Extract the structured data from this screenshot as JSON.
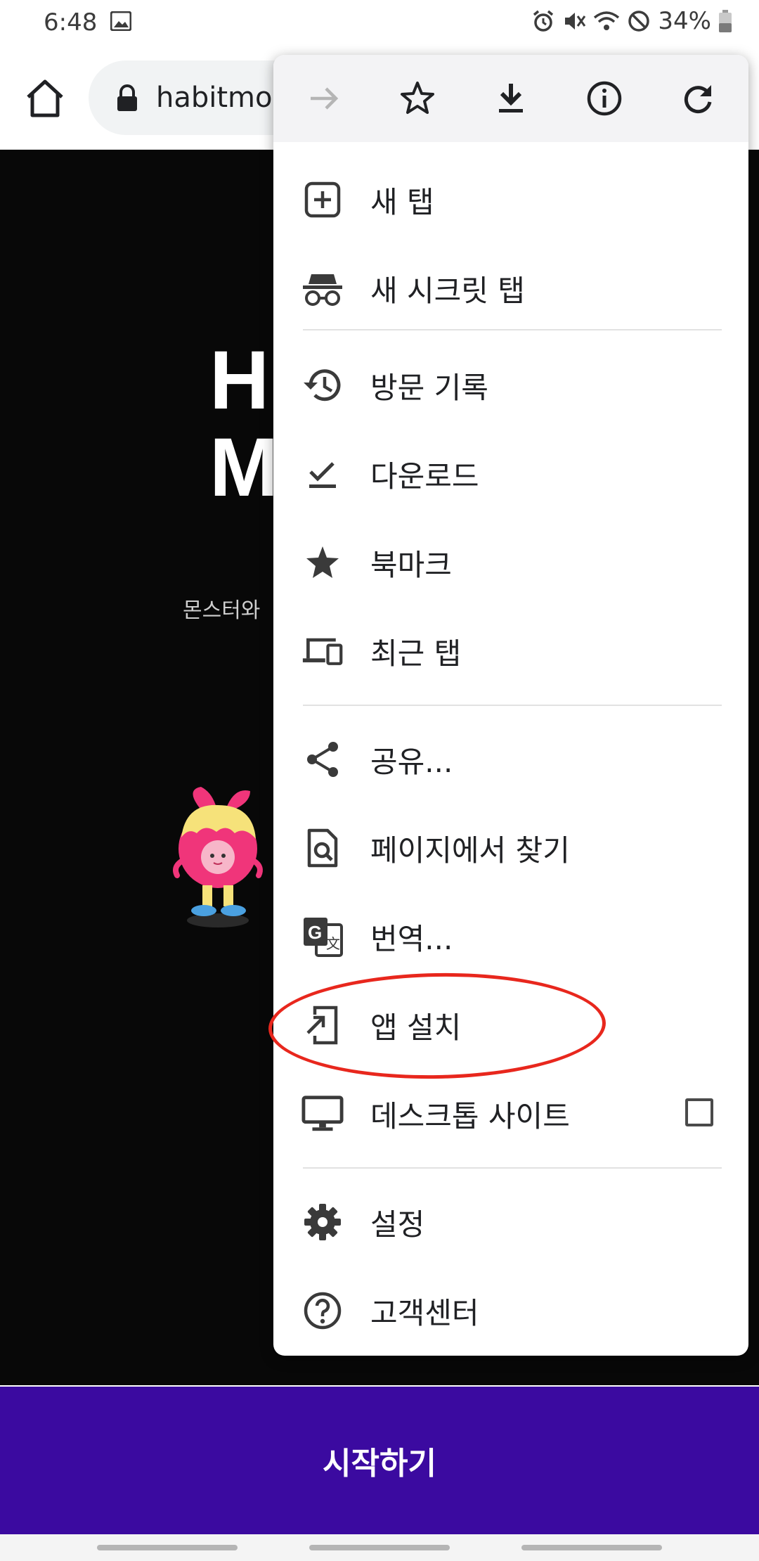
{
  "status": {
    "time": "6:48",
    "battery": "34%"
  },
  "browser": {
    "url": "habitmo"
  },
  "page": {
    "hero_line1": "H",
    "hero_line2": "M",
    "subtitle": "몬스터와",
    "start_button": "시작하기"
  },
  "menu": {
    "top_icons": [
      "forward-icon",
      "bookmark-star-icon",
      "download-icon",
      "info-icon",
      "refresh-icon"
    ],
    "items": [
      {
        "label": "새 탭",
        "icon": "new-tab-icon"
      },
      {
        "label": "새 시크릿 탭",
        "icon": "incognito-icon"
      },
      {
        "label": "방문 기록",
        "icon": "history-icon"
      },
      {
        "label": "다운로드",
        "icon": "downloads-check-icon"
      },
      {
        "label": "북마크",
        "icon": "bookmarks-star-icon"
      },
      {
        "label": "최근 탭",
        "icon": "recent-tabs-icon"
      },
      {
        "label": "공유...",
        "icon": "share-icon"
      },
      {
        "label": "페이지에서 찾기",
        "icon": "find-in-page-icon"
      },
      {
        "label": "번역...",
        "icon": "translate-icon"
      },
      {
        "label": "앱 설치",
        "icon": "install-app-icon"
      },
      {
        "label": "데스크톱 사이트",
        "icon": "desktop-icon",
        "checked": false
      },
      {
        "label": "설정",
        "icon": "settings-gear-icon"
      },
      {
        "label": "고객센터",
        "icon": "help-icon"
      }
    ]
  },
  "colors": {
    "start_button": "#3b0aa0",
    "highlight": "#e8271d",
    "page_bg": "#080808"
  }
}
